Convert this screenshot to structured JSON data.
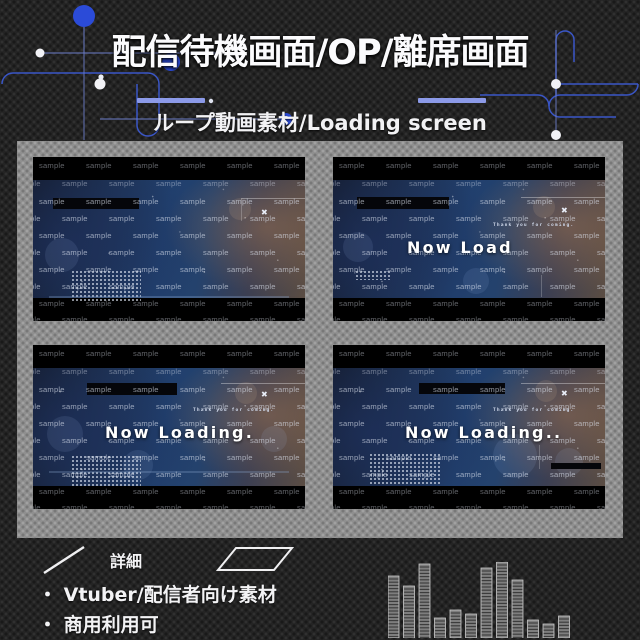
{
  "header": {
    "title": "配信待機画面/OP/離席画面",
    "subtitle": "ループ動画素材/Loading screen",
    "accent_blue": "#2b4bd8",
    "accent_lavender": "#8c9ae8",
    "line_blue": "#3a56c7"
  },
  "previews": [
    {
      "id": "preview-1",
      "status_text": "",
      "thanks_text": "",
      "close_icon": "✖",
      "watermark": "sample"
    },
    {
      "id": "preview-2",
      "status_text": "Now Load",
      "thanks_text": "Thank you for coming.",
      "close_icon": "✖",
      "watermark": "sample"
    },
    {
      "id": "preview-3",
      "status_text": "Now Loading.",
      "thanks_text": "Thank you for coming.",
      "close_icon": "✖",
      "watermark": "sample"
    },
    {
      "id": "preview-4",
      "status_text": "Now Loading..",
      "thanks_text": "Thank you for coming.",
      "close_icon": "✖",
      "watermark": "sample"
    }
  ],
  "footer": {
    "detail_label": "詳細",
    "bullets": [
      "・ Vtuber/配信者向け素材",
      "・ 商用利用可"
    ],
    "equalizer_levels": [
      62,
      52,
      74,
      20,
      28,
      24,
      70,
      76,
      58,
      18,
      14,
      22
    ]
  }
}
